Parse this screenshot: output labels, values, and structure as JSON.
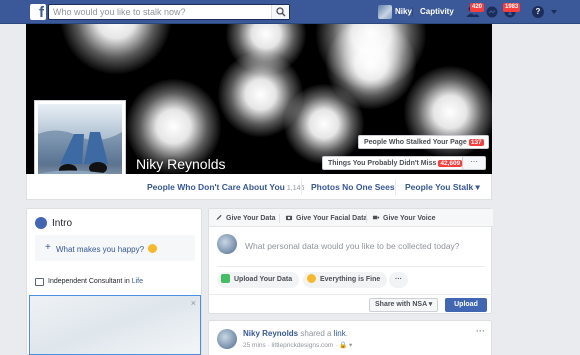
{
  "topbar": {
    "logo": "f",
    "search_placeholder": "Who would you like to stalk now?",
    "user_name": "Niky",
    "link": "Captivity",
    "friend_badge": "420",
    "notif_badge": "1983",
    "help": "?"
  },
  "cover": {
    "name": "Niky Reynolds",
    "stalked_label": "People Who Stalked Your Page",
    "stalked_count": "137",
    "things_label": "Things You Probably Didn't Miss",
    "things_count": "42,609",
    "more": "···"
  },
  "timeline_nav": {
    "items": [
      {
        "label": "People Who Don't Care About You",
        "count": "1,146"
      },
      {
        "label": "Photos No One Sees"
      },
      {
        "label": "People You Stalk ▾"
      }
    ]
  },
  "intro": {
    "title": "Intro",
    "happy": "What makes you happy?",
    "plus": "+",
    "job_prefix": "Independent Consultant in ",
    "job_link": "Life",
    "close": "×"
  },
  "composer": {
    "tabs": [
      "Give Your Data",
      "Give Your Facial Data",
      "Give Your Voice"
    ],
    "prompt": "What personal data would you like to be collected today?",
    "upload_label": "Upload Your Data",
    "fine_label": "Everything is Fine",
    "more": "···",
    "share_label": "Share with NSA ▾",
    "post_label": "Upload"
  },
  "post": {
    "author": "Niky Reynolds",
    "verb": " shared a ",
    "link": "link",
    "period": ".",
    "meta": "25 mins · littleprickdesigns.com · 🔒 ▾",
    "dots": "···"
  },
  "colors": {
    "brand": "#3b5998",
    "link": "#365899",
    "badge": "#fa3e3e",
    "button": "#4267b2"
  }
}
